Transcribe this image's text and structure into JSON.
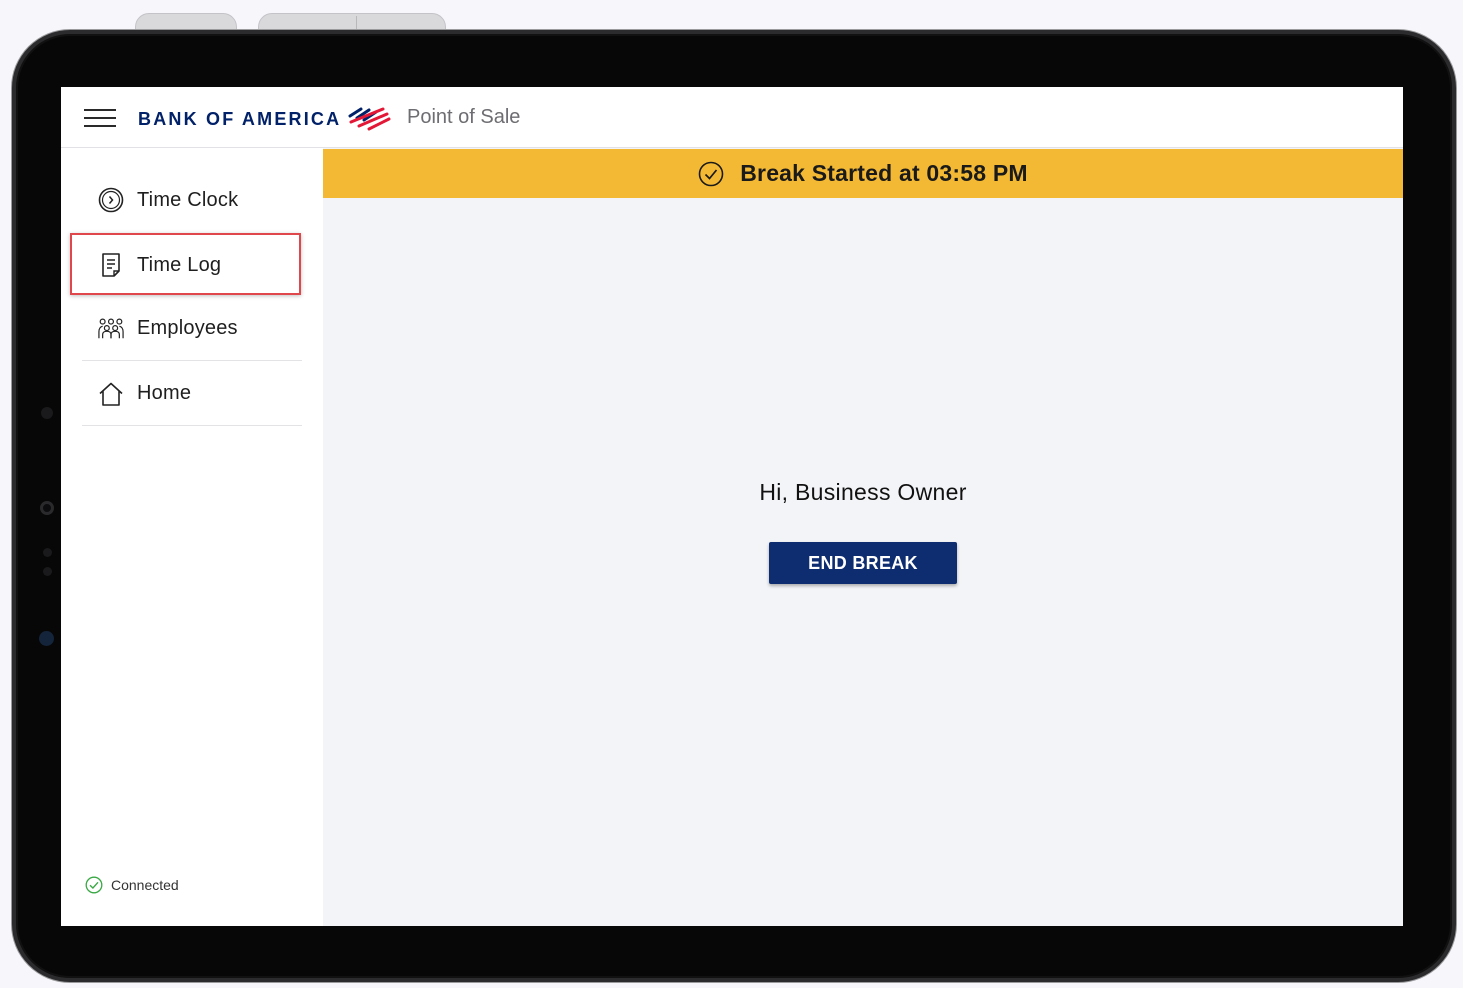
{
  "header": {
    "brand": "BANK OF AMERICA",
    "app_name": "Point of Sale",
    "menu_icon": "hamburger-icon",
    "logo_icon": "flag-logo-icon"
  },
  "sidebar": {
    "items": [
      {
        "label": "Time Clock",
        "icon": "clock-icon"
      },
      {
        "label": "Time Log",
        "icon": "document-icon",
        "highlighted": true
      },
      {
        "label": "Employees",
        "icon": "people-icon"
      },
      {
        "label": "Home",
        "icon": "home-icon"
      }
    ],
    "status": {
      "label": "Connected",
      "icon": "check-circle-icon",
      "color": "#3aa845"
    }
  },
  "banner": {
    "text": "Break Started at 03:58 PM",
    "icon": "check-circle-icon",
    "color": "#f4b934"
  },
  "main": {
    "greeting": "Hi, Business Owner",
    "end_break_label": "END BREAK",
    "button_color": "#0e2c70"
  },
  "colors": {
    "brand_navy": "#012169",
    "brand_red": "#e31837",
    "highlight_red": "#e0474c"
  }
}
